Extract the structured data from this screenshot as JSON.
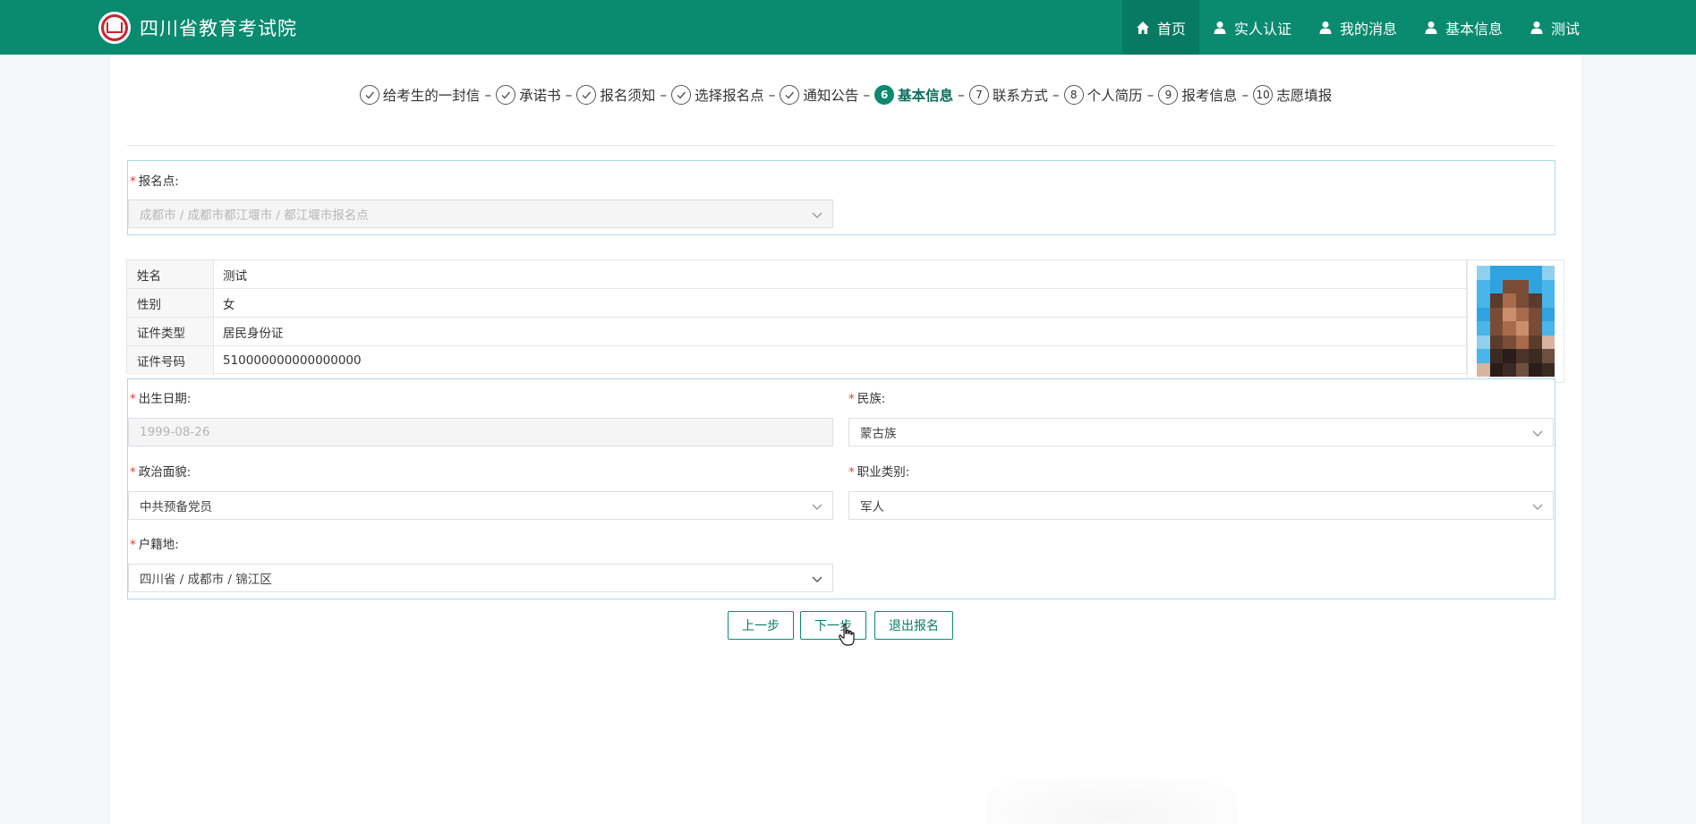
{
  "header": {
    "site_title": "四川省教育考试院",
    "nav": [
      {
        "label": "首页",
        "icon": "home-icon",
        "active": true
      },
      {
        "label": "实人认证",
        "icon": "user-icon",
        "active": false
      },
      {
        "label": "我的消息",
        "icon": "user-icon",
        "active": false
      },
      {
        "label": "基本信息",
        "icon": "user-icon",
        "active": false
      },
      {
        "label": "测试",
        "icon": "user-icon",
        "active": false
      }
    ]
  },
  "steps": [
    {
      "label": "给考生的一封信",
      "state": "done"
    },
    {
      "label": "承诺书",
      "state": "done"
    },
    {
      "label": "报名须知",
      "state": "done"
    },
    {
      "label": "选择报名点",
      "state": "done"
    },
    {
      "label": "通知公告",
      "state": "done"
    },
    {
      "label": "基本信息",
      "state": "current",
      "num": "6"
    },
    {
      "label": "联系方式",
      "state": "todo",
      "num": "7"
    },
    {
      "label": "个人简历",
      "state": "todo",
      "num": "8"
    },
    {
      "label": "报考信息",
      "state": "todo",
      "num": "9"
    },
    {
      "label": "志愿填报",
      "state": "todo",
      "num": "10"
    }
  ],
  "step_separator": "–",
  "form": {
    "registration_point": {
      "label": "报名点:",
      "value": "成都市 / 成都市都江堰市 / 都江堰市报名点"
    },
    "info": [
      {
        "key": "姓名",
        "value": "测试"
      },
      {
        "key": "性别",
        "value": "女"
      },
      {
        "key": "证件类型",
        "value": "居民身份证"
      },
      {
        "key": "证件号码",
        "value": "510000000000000000"
      }
    ],
    "birth_date": {
      "label": "出生日期:",
      "value": "1999-08-26"
    },
    "ethnicity": {
      "label": "民族:",
      "value": "蒙古族"
    },
    "political_status": {
      "label": "政治面貌:",
      "value": "中共预备党员"
    },
    "occupation": {
      "label": "职业类别:",
      "value": "军人"
    },
    "household": {
      "label": "户籍地:",
      "value": "四川省 / 成都市 / 锦江区"
    }
  },
  "buttons": {
    "prev": "上一步",
    "next": "下一步",
    "exit": "退出报名"
  },
  "colors": {
    "brand": "#0a8a6f",
    "section_border": "#a9dbec",
    "required": "#e6393c"
  }
}
